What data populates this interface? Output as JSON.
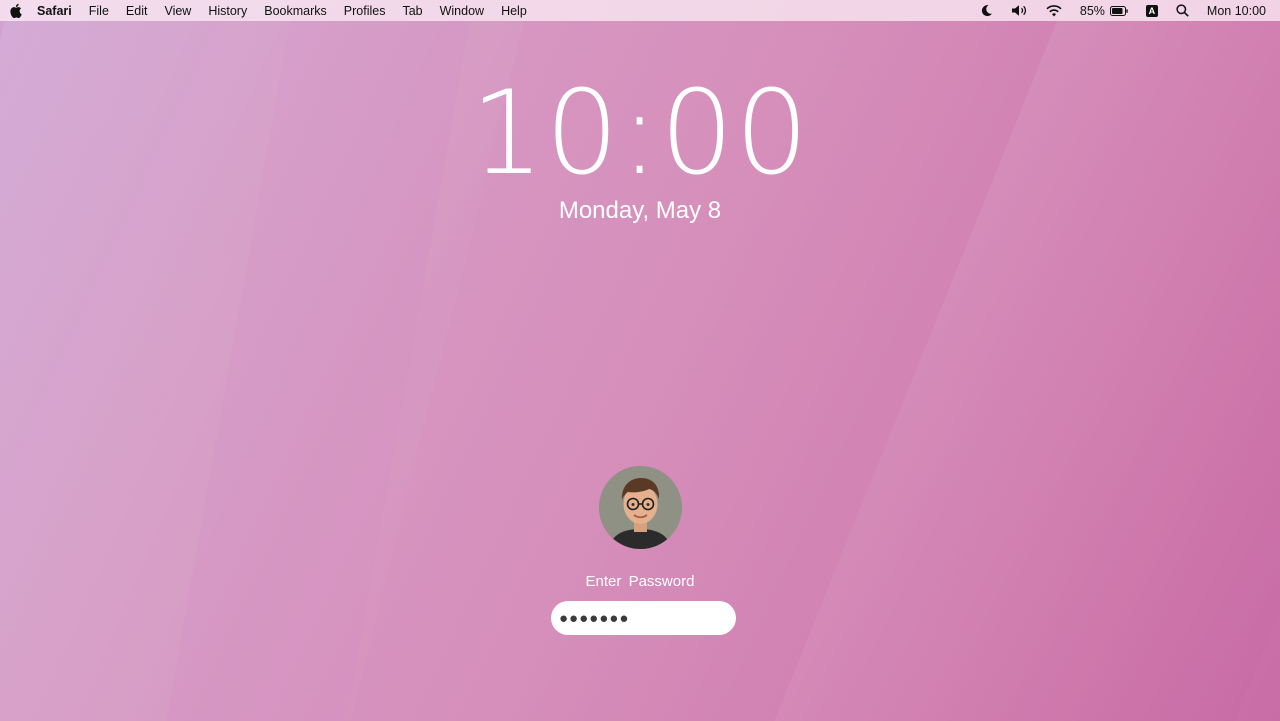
{
  "menubar": {
    "apple_icon": "apple-icon",
    "app_name": "Safari",
    "items": [
      "File",
      "Edit",
      "View",
      "History",
      "Bookmarks",
      "Profiles",
      "Tab",
      "Window",
      "Help"
    ],
    "status": {
      "battery_percent": "85%",
      "input_source": "A",
      "clock": "Mon 10:00"
    }
  },
  "lock": {
    "time": "10:00",
    "date": "Monday, May 8",
    "prompt": "Enter  Password",
    "password_value": "●●●●●●●"
  }
}
